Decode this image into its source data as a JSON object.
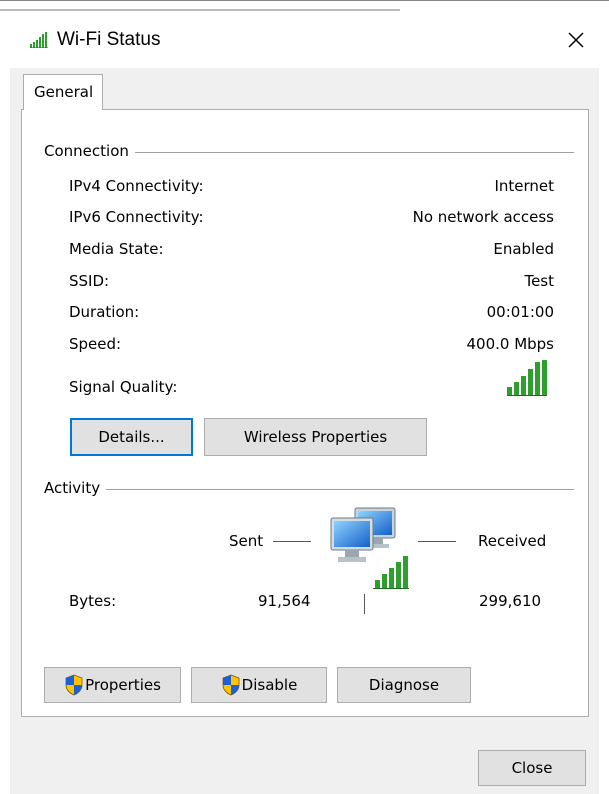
{
  "window": {
    "title": "Wi-Fi Status",
    "title_icon": "wifi-signal-icon",
    "close_icon": "close-icon"
  },
  "tabs": [
    {
      "label": "General",
      "active": true
    }
  ],
  "connection": {
    "group_label": "Connection",
    "rows": [
      {
        "label": "IPv4 Connectivity:",
        "value": "Internet"
      },
      {
        "label": "IPv6 Connectivity:",
        "value": "No network access"
      },
      {
        "label": "Media State:",
        "value": "Enabled"
      },
      {
        "label": "SSID:",
        "value": "Test"
      },
      {
        "label": "Duration:",
        "value": "00:01:00"
      },
      {
        "label": "Speed:",
        "value": "400.0 Mbps"
      }
    ],
    "signal_label": "Signal Quality:",
    "signal_icon": "signal-strength-icon",
    "signal_bars": 5,
    "details_button": "Details...",
    "wireless_properties_button": "Wireless Properties"
  },
  "activity": {
    "group_label": "Activity",
    "sent_label": "Sent",
    "received_label": "Received",
    "bytes_label": "Bytes:",
    "bytes_sent": "91,564",
    "bytes_received": "299,610",
    "network_icon": "network-computers-icon"
  },
  "actions": {
    "properties_button": "Properties",
    "disable_button": "Disable",
    "diagnose_button": "Diagnose",
    "shield_icon": "uac-shield-icon"
  },
  "footer": {
    "close_button": "Close"
  },
  "colors": {
    "accent": "#0078d7",
    "signal_green": "#2e9e2e",
    "dialog_bg": "#f0f0f0",
    "button_bg": "#e1e1e1"
  }
}
